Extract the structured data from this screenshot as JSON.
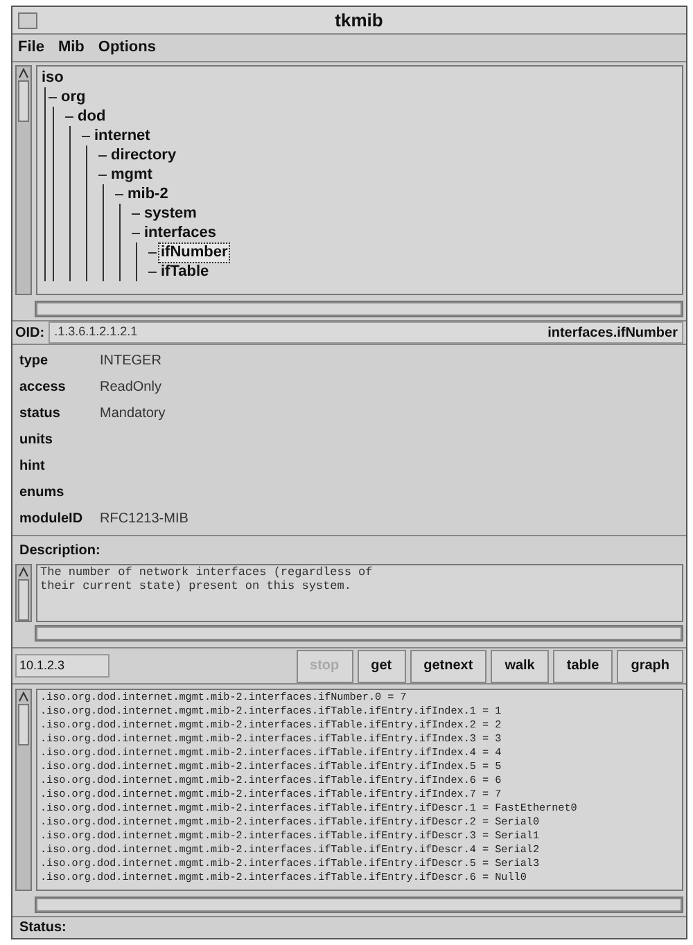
{
  "window": {
    "title": "tkmib"
  },
  "menu": [
    "File",
    "Mib",
    "Options"
  ],
  "tree": [
    {
      "label": "iso",
      "selected": false,
      "children": [
        {
          "label": "org",
          "selected": false,
          "children": [
            {
              "label": "dod",
              "selected": false,
              "children": [
                {
                  "label": "internet",
                  "selected": false,
                  "children": [
                    {
                      "label": "directory",
                      "selected": false
                    },
                    {
                      "label": "mgmt",
                      "selected": false,
                      "children": [
                        {
                          "label": "mib-2",
                          "selected": false,
                          "children": [
                            {
                              "label": "system",
                              "selected": false
                            },
                            {
                              "label": "interfaces",
                              "selected": false,
                              "children": [
                                {
                                  "label": "ifNumber",
                                  "selected": true
                                },
                                {
                                  "label": "ifTable",
                                  "selected": false
                                }
                              ]
                            }
                          ]
                        }
                      ]
                    }
                  ]
                }
              ]
            }
          ]
        }
      ]
    }
  ],
  "oid": {
    "label": "OID:",
    "value": ".1.3.6.1.2.1.2.1",
    "name": "interfaces.ifNumber"
  },
  "properties": [
    {
      "key": "type",
      "value": "INTEGER"
    },
    {
      "key": "access",
      "value": "ReadOnly"
    },
    {
      "key": "status",
      "value": "Mandatory"
    },
    {
      "key": "units"
    },
    {
      "key": "hint"
    },
    {
      "key": "enums"
    },
    {
      "key": "moduleID",
      "value": "RFC1213-MIB"
    }
  ],
  "description": {
    "label": "Description:",
    "lines": [
      "The number of network interfaces (regardless of",
      "their current state) present on this system."
    ]
  },
  "host": {
    "value": "10.1.2.3"
  },
  "buttons": [
    {
      "label": "stop",
      "disabled": true
    },
    {
      "label": "get",
      "disabled": false
    },
    {
      "label": "getnext",
      "disabled": false
    },
    {
      "label": "walk",
      "disabled": false
    },
    {
      "label": "table",
      "disabled": false
    },
    {
      "label": "graph",
      "disabled": false
    }
  ],
  "output": [
    ".iso.org.dod.internet.mgmt.mib-2.interfaces.ifNumber.0 = 7",
    ".iso.org.dod.internet.mgmt.mib-2.interfaces.ifTable.ifEntry.ifIndex.1 = 1",
    ".iso.org.dod.internet.mgmt.mib-2.interfaces.ifTable.ifEntry.ifIndex.2 = 2",
    ".iso.org.dod.internet.mgmt.mib-2.interfaces.ifTable.ifEntry.ifIndex.3 = 3",
    ".iso.org.dod.internet.mgmt.mib-2.interfaces.ifTable.ifEntry.ifIndex.4 = 4",
    ".iso.org.dod.internet.mgmt.mib-2.interfaces.ifTable.ifEntry.ifIndex.5 = 5",
    ".iso.org.dod.internet.mgmt.mib-2.interfaces.ifTable.ifEntry.ifIndex.6 = 6",
    ".iso.org.dod.internet.mgmt.mib-2.interfaces.ifTable.ifEntry.ifIndex.7 = 7",
    ".iso.org.dod.internet.mgmt.mib-2.interfaces.ifTable.ifEntry.ifDescr.1 = FastEthernet0",
    ".iso.org.dod.internet.mgmt.mib-2.interfaces.ifTable.ifEntry.ifDescr.2 = Serial0",
    ".iso.org.dod.internet.mgmt.mib-2.interfaces.ifTable.ifEntry.ifDescr.3 = Serial1",
    ".iso.org.dod.internet.mgmt.mib-2.interfaces.ifTable.ifEntry.ifDescr.4 = Serial2",
    ".iso.org.dod.internet.mgmt.mib-2.interfaces.ifTable.ifEntry.ifDescr.5 = Serial3",
    ".iso.org.dod.internet.mgmt.mib-2.interfaces.ifTable.ifEntry.ifDescr.6 = Null0"
  ],
  "status": {
    "label": "Status:"
  }
}
